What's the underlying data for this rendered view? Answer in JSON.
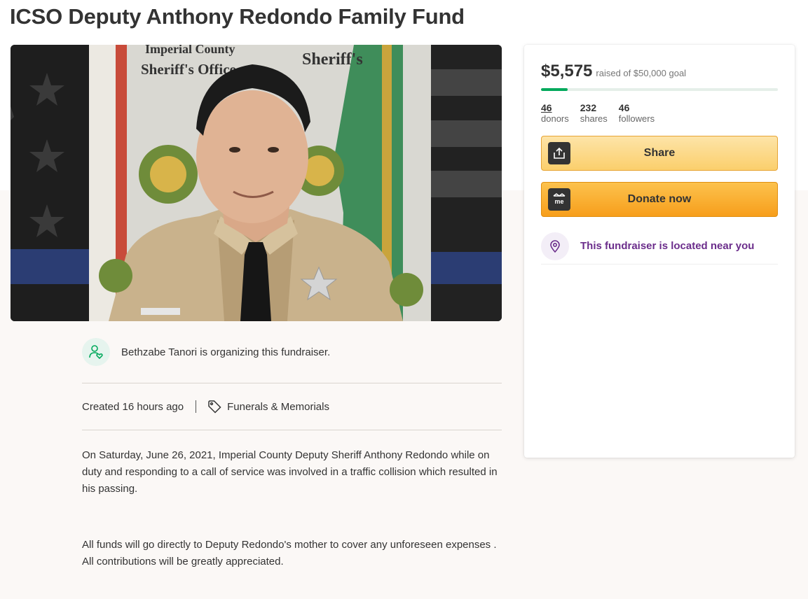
{
  "page": {
    "title": "ICSO Deputy Anthony Redondo Family Fund"
  },
  "hero": {
    "image_alt": "Photo of Deputy Anthony Redondo in uniform in front of Imperial County Sheriff's Office banner",
    "banner_text_1": "Imperial County",
    "banner_text_2": "Sheriff's Office",
    "banner_text_3": "Sheriff's"
  },
  "organizer": {
    "text": "Bethzabe Tanori is organizing this fundraiser."
  },
  "meta": {
    "created": "Created 16 hours ago",
    "category": "Funerals & Memorials"
  },
  "story": {
    "paragraph_1": "On Saturday, June 26, 2021, Imperial County Deputy Sheriff Anthony Redondo while on duty and responding to a call of service was involved in a traffic collision which resulted in his passing.",
    "paragraph_2": "All funds will go directly to Deputy Redondo's mother to cover any unforeseen expenses . All contributions will be greatly appreciated."
  },
  "donation_card": {
    "raised_amount": "$5,575",
    "goal_text": "raised of $50,000 goal",
    "progress_fraction": 0.1115,
    "stats": [
      {
        "value": "46",
        "label": "donors"
      },
      {
        "value": "232",
        "label": "shares"
      },
      {
        "value": "46",
        "label": "followers"
      }
    ],
    "share_label": "Share",
    "donate_label": "Donate now",
    "donate_icon_text": "me",
    "nearby_text": "This fundraiser is located near you"
  },
  "icons": {
    "share": "share-upload-icon",
    "donate": "gofundme-logo-icon",
    "location": "location-pin-icon",
    "organizer": "user-heart-icon",
    "category": "tag-icon"
  },
  "colors": {
    "progress": "#02a95c",
    "share_button": "#fbcf6c",
    "donate_button": "#f79e1b",
    "nearby_text": "#6b2d8b"
  }
}
